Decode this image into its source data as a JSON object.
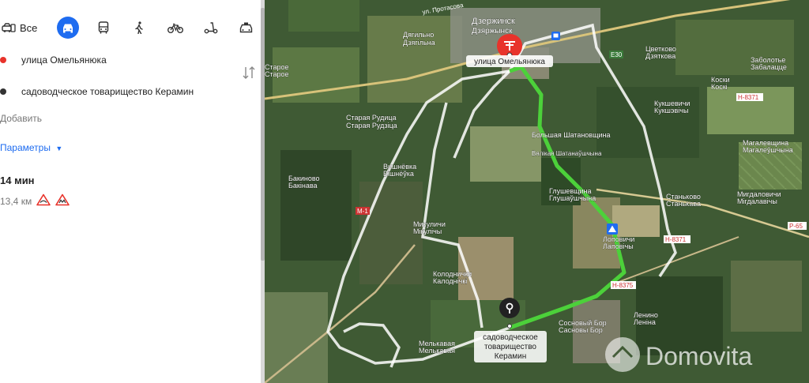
{
  "route_panel": {
    "modes": [
      {
        "id": "all",
        "label": "Все",
        "icon": "car-taxi-icon"
      },
      {
        "id": "car",
        "icon": "car-icon",
        "active": true
      },
      {
        "id": "transit",
        "icon": "bus-icon"
      },
      {
        "id": "walk",
        "icon": "pedestrian-icon"
      },
      {
        "id": "bike",
        "icon": "bicycle-icon"
      },
      {
        "id": "scooter",
        "icon": "scooter-icon"
      },
      {
        "id": "taxi",
        "icon": "taxi-icon"
      }
    ],
    "waypoints": [
      {
        "label": "улица Омельянюка",
        "color": "#e8332b"
      },
      {
        "label": "садоводческое товарищество Керамин",
        "color": "#333333"
      }
    ],
    "add_label": "Добавить",
    "params_label": "Параметры",
    "route": {
      "time": "14 мин",
      "distance": "13,4 км",
      "warnings": [
        "speed-bump-icon",
        "rough-road-icon"
      ]
    },
    "accent_color": "#1e6cf0"
  },
  "map": {
    "route_color": "#4cd13a",
    "alt_route_color": "#ffffff",
    "place_labels": [
      {
        "id": "dzerzhinsk",
        "text": "Дзержинск",
        "sub": "Дзяржынск"
      },
      {
        "id": "dyagilno",
        "text": "Дягильно",
        "sub": "Дзягільна"
      },
      {
        "id": "tsvetkovo",
        "text": "Цветково",
        "sub": "Дзяткова"
      },
      {
        "id": "zabolotie",
        "text": "Заболотье",
        "sub": "Забалацце"
      },
      {
        "id": "koski",
        "text": "Коски",
        "sub": "Коскі"
      },
      {
        "id": "kukshevichi",
        "text": "Кукшевичи",
        "sub": "Кукшэвічы"
      },
      {
        "id": "staraya-rudica",
        "text": "Старая Рудица",
        "sub": "Старая Рудзіца"
      },
      {
        "id": "bolshaya-shatanovshchina",
        "text": "Большая Шатановщина",
        "sub": "Вялікая Шатанаўшчына"
      },
      {
        "id": "magalevshchina",
        "text": "Магалевщина",
        "sub": "Магалеўшчына"
      },
      {
        "id": "vishnevka",
        "text": "Вишнёвка",
        "sub": "Вішнёўка"
      },
      {
        "id": "bakinovo",
        "text": "Бакиново",
        "sub": "Бакінава"
      },
      {
        "id": "gulyushchina",
        "text": "Глушевщина",
        "sub": "Глушаўшчына"
      },
      {
        "id": "stankovo",
        "text": "Станьково",
        "sub": "Станькава"
      },
      {
        "id": "migdalovichi",
        "text": "Мигдаловичи",
        "sub": "Мігдалавічы"
      },
      {
        "id": "lyubovichi",
        "text": "Лоповичи",
        "sub": "Лаповічы"
      },
      {
        "id": "mikulichi",
        "text": "Микуличи",
        "sub": "Мікулічы"
      },
      {
        "id": "kolodnichi",
        "text": "Колоднички",
        "sub": "Калоднічкі"
      },
      {
        "id": "sosnovy-bor",
        "text": "Сосновый Бор",
        "sub": "Сасновы Бор"
      },
      {
        "id": "lenino",
        "text": "Ленино",
        "sub": "Леніна"
      },
      {
        "id": "staroe",
        "text": "Старое",
        "sub": "Старое"
      },
      {
        "id": "malaya",
        "text": "Мелькавая",
        "sub": "Мелькавая"
      }
    ],
    "road_labels": [
      {
        "id": "protasova",
        "text": "ул. Протасова"
      },
      {
        "id": "e30",
        "text": "E30"
      },
      {
        "id": "n8371",
        "text": "Н-8371"
      },
      {
        "id": "r65",
        "text": "Р-65"
      },
      {
        "id": "n8375",
        "text": "Н-8375"
      },
      {
        "id": "n8371b",
        "text": "Н-8371"
      },
      {
        "id": "m1",
        "text": "М-1"
      }
    ],
    "start_label": "улица Омельянюка",
    "end_label": [
      "садоводческое",
      "товарищество",
      "Керамин"
    ],
    "watermark": "Domovita"
  }
}
